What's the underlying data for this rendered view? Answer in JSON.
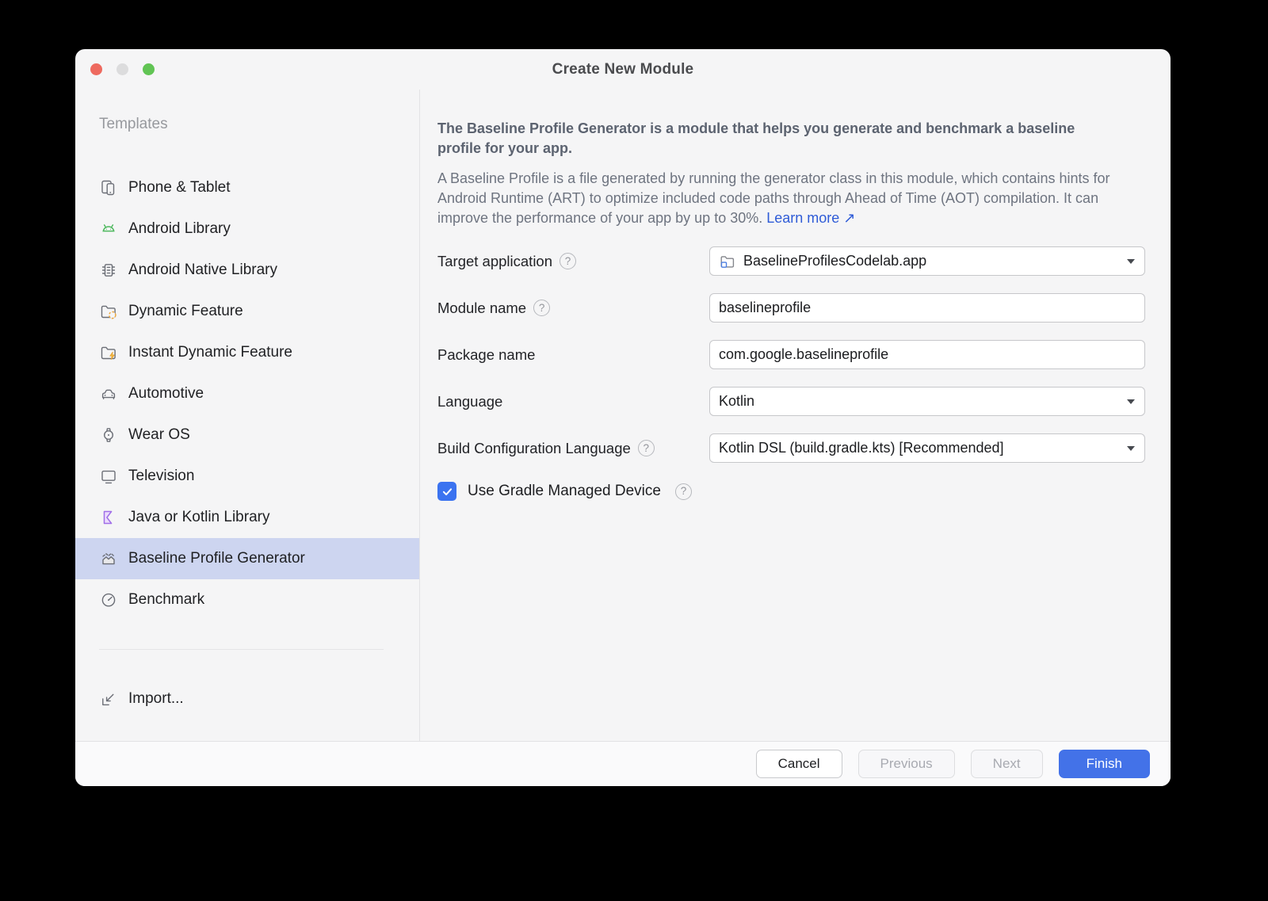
{
  "window": {
    "title": "Create New Module",
    "traffic_lights": [
      "close",
      "minimize",
      "zoom"
    ]
  },
  "sidebar": {
    "header": "Templates",
    "items": [
      {
        "label": "Phone & Tablet",
        "icon": "phone-tablet-icon",
        "selected": false
      },
      {
        "label": "Android Library",
        "icon": "android-icon",
        "selected": false
      },
      {
        "label": "Android Native Library",
        "icon": "chip-icon",
        "selected": false
      },
      {
        "label": "Dynamic Feature",
        "icon": "dynamic-feature-icon",
        "selected": false
      },
      {
        "label": "Instant Dynamic Feature",
        "icon": "instant-dynamic-feature-icon",
        "selected": false
      },
      {
        "label": "Automotive",
        "icon": "car-icon",
        "selected": false
      },
      {
        "label": "Wear OS",
        "icon": "watch-icon",
        "selected": false
      },
      {
        "label": "Television",
        "icon": "tv-icon",
        "selected": false
      },
      {
        "label": "Java or Kotlin Library",
        "icon": "kotlin-icon",
        "selected": false
      },
      {
        "label": "Baseline Profile Generator",
        "icon": "baseline-chart-icon",
        "selected": true
      },
      {
        "label": "Benchmark",
        "icon": "speedometer-icon",
        "selected": false
      }
    ],
    "import_label": "Import..."
  },
  "description": {
    "bold": "The Baseline Profile Generator is a module that helps you generate and benchmark a baseline profile for your app.",
    "body": "A Baseline Profile is a file generated by running the generator class in this module, which contains hints for Android Runtime (ART) to optimize included code paths through Ahead of Time (AOT) compilation. It can improve the performance of your app by up to 30%. ",
    "link": "Learn more",
    "link_arrow": "↗"
  },
  "form": {
    "help_glyph": "?",
    "target_application": {
      "label": "Target application",
      "value": "BaselineProfilesCodelab.app",
      "icon": "module-folder-icon"
    },
    "module_name": {
      "label": "Module name",
      "value": "baselineprofile"
    },
    "package_name": {
      "label": "Package name",
      "value": "com.google.baselineprofile"
    },
    "language": {
      "label": "Language",
      "value": "Kotlin"
    },
    "build_config": {
      "label": "Build Configuration Language",
      "value": "Kotlin DSL (build.gradle.kts) [Recommended]"
    },
    "gradle_managed": {
      "label": "Use Gradle Managed Device",
      "checked": true
    }
  },
  "footer": {
    "cancel": "Cancel",
    "previous": "Previous",
    "next": "Next",
    "finish": "Finish"
  },
  "colors": {
    "accent_blue": "#4372e8",
    "link_blue": "#2e5bd7",
    "checkbox_blue": "#3b73f0",
    "selection_highlight": "#cdd5f0",
    "traffic_red": "#ee6a5f",
    "traffic_gray": "#dcdcdd",
    "traffic_green": "#61c454",
    "window_bg": "#f5f5f6"
  }
}
